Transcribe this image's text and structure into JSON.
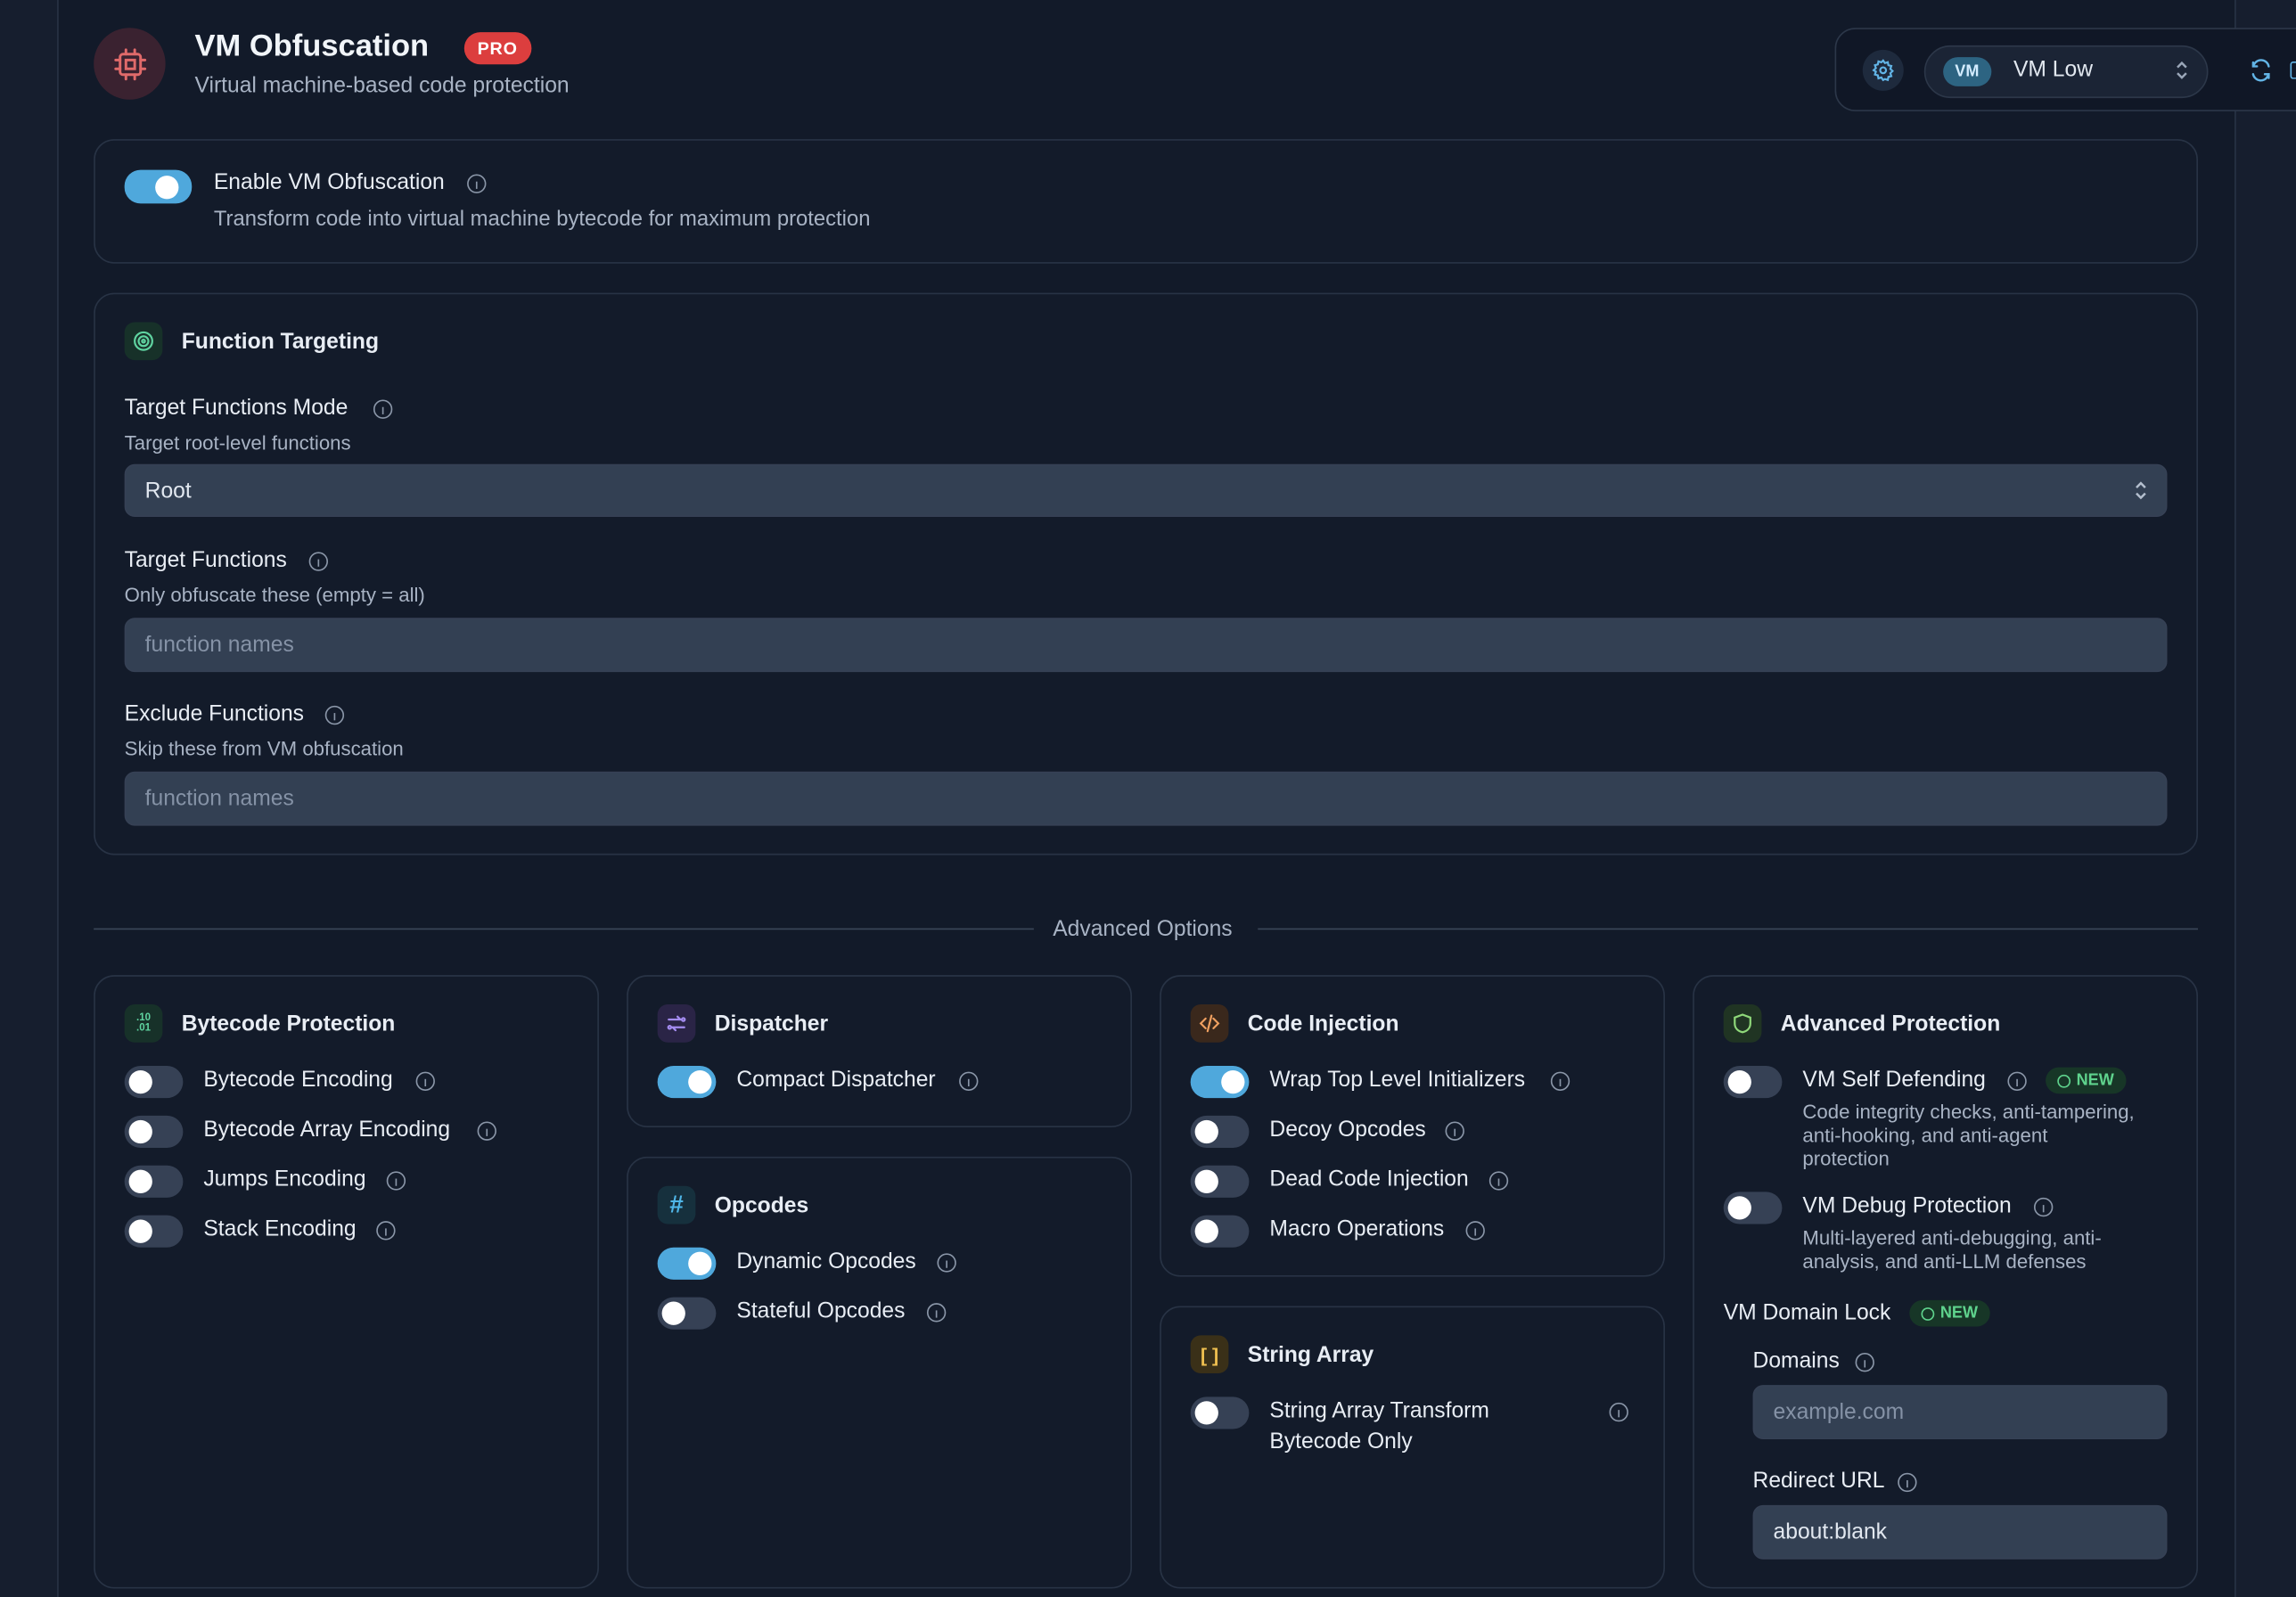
{
  "header": {
    "title": "VM Obfuscation",
    "badge": "PRO",
    "subtitle": "Virtual machine-based code protection"
  },
  "preset": {
    "badge": "VM",
    "label": "VM Low"
  },
  "enable": {
    "label": "Enable VM Obfuscation",
    "description": "Transform code into virtual machine bytecode for maximum protection",
    "on": true
  },
  "targeting": {
    "title": "Function Targeting",
    "mode_label": "Target Functions Mode",
    "mode_desc": "Target root-level functions",
    "mode_value": "Root",
    "target_label": "Target Functions",
    "target_desc": "Only obfuscate these (empty = all)",
    "target_placeholder": "function names",
    "exclude_label": "Exclude Functions",
    "exclude_desc": "Skip these from VM obfuscation",
    "exclude_placeholder": "function names"
  },
  "advanced_label": "Advanced Options",
  "bytecode": {
    "title": "Bytecode Protection",
    "icon_text": ".10 .01",
    "items": [
      {
        "label": "Bytecode Encoding",
        "on": false
      },
      {
        "label": "Bytecode Array Encoding",
        "on": false
      },
      {
        "label": "Jumps Encoding",
        "on": false
      },
      {
        "label": "Stack Encoding",
        "on": false
      }
    ]
  },
  "dispatcher": {
    "title": "Dispatcher",
    "items": [
      {
        "label": "Compact Dispatcher",
        "on": true
      }
    ]
  },
  "opcodes": {
    "title": "Opcodes",
    "icon_text": "#",
    "items": [
      {
        "label": "Dynamic Opcodes",
        "on": true
      },
      {
        "label": "Stateful Opcodes",
        "on": false
      }
    ]
  },
  "injection": {
    "title": "Code Injection",
    "items": [
      {
        "label": "Wrap Top Level Initializers",
        "on": true
      },
      {
        "label": "Decoy Opcodes",
        "on": false
      },
      {
        "label": "Dead Code Injection",
        "on": false
      },
      {
        "label": "Macro Operations",
        "on": false
      }
    ]
  },
  "string_array": {
    "title": "String Array",
    "icon_text": "[ ]",
    "item_line1": "String Array Transform",
    "item_line2": "Bytecode Only",
    "on": false
  },
  "advanced_protection": {
    "title": "Advanced Protection",
    "self_defending": {
      "label": "VM Self Defending",
      "badge": "NEW",
      "desc1": "Code integrity checks, anti-tampering,",
      "desc2": "anti-hooking, and anti-agent",
      "desc3": "protection",
      "on": false
    },
    "debug": {
      "label": "VM Debug Protection",
      "desc1": "Multi-layered anti-debugging, anti-",
      "desc2": "analysis, and anti-LLM defenses",
      "on": false
    },
    "domain_lock": {
      "label": "VM Domain Lock",
      "badge": "NEW",
      "domains_label": "Domains",
      "domains_placeholder": "example.com",
      "redirect_label": "Redirect URL",
      "redirect_value": "about:blank"
    }
  },
  "colors": {
    "accent": "#4fa8dc",
    "pro_badge": "#dc3e3e",
    "new_badge": "#5fd38d"
  }
}
